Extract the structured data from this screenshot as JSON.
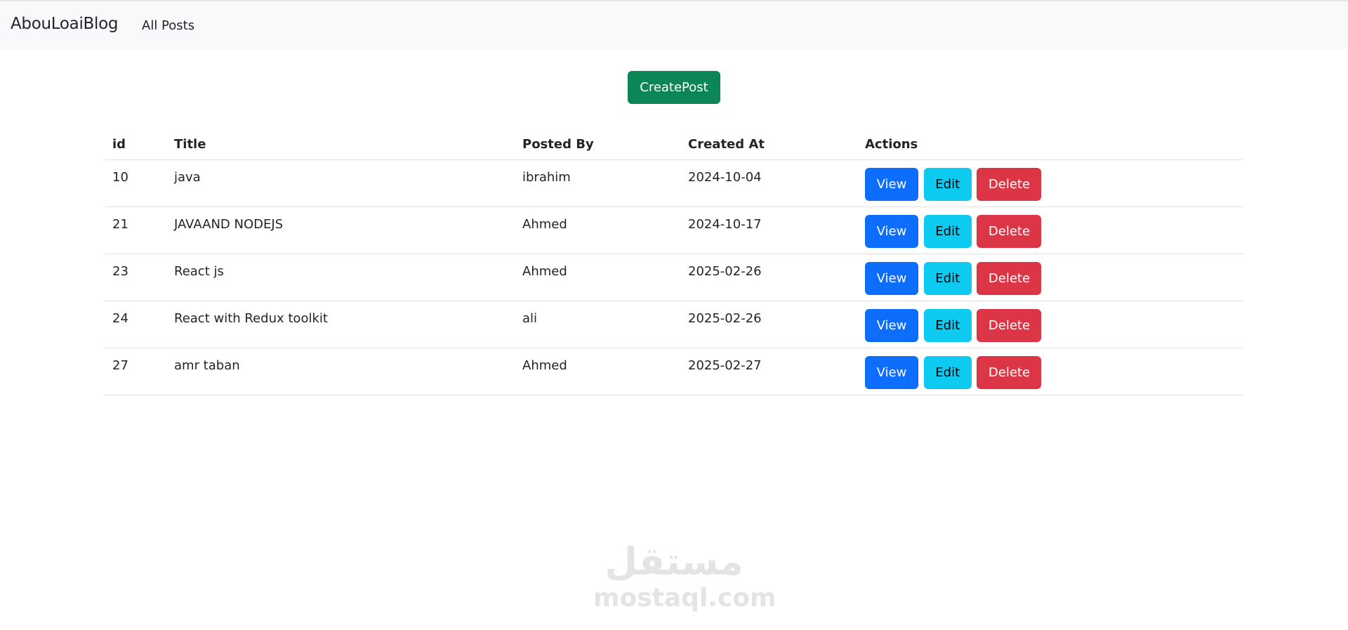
{
  "navbar": {
    "brand": "AbouLoaiBlog",
    "links": [
      "All Posts"
    ]
  },
  "create_button": "CreatePost",
  "table": {
    "headers": [
      "id",
      "Title",
      "Posted By",
      "Created At",
      "Actions"
    ],
    "rows": [
      {
        "id": "10",
        "title": "java",
        "posted_by": "ibrahim",
        "created_at": "2024-10-04"
      },
      {
        "id": "21",
        "title": "JAVAAND NODEJS",
        "posted_by": "Ahmed",
        "created_at": "2024-10-17"
      },
      {
        "id": "23",
        "title": "React js",
        "posted_by": "Ahmed",
        "created_at": "2025-02-26"
      },
      {
        "id": "24",
        "title": "React with Redux toolkit",
        "posted_by": "ali",
        "created_at": "2025-02-26"
      },
      {
        "id": "27",
        "title": "amr taban",
        "posted_by": "Ahmed",
        "created_at": "2025-02-27"
      }
    ],
    "actions": {
      "view": "View",
      "edit": "Edit",
      "delete": "Delete"
    }
  },
  "watermark": {
    "arabic": "مستقل",
    "latin": "mostaql.com"
  },
  "colors": {
    "primary": "#0d6efd",
    "info": "#0dcaf0",
    "danger": "#dc3545",
    "success": "#0c8656"
  }
}
